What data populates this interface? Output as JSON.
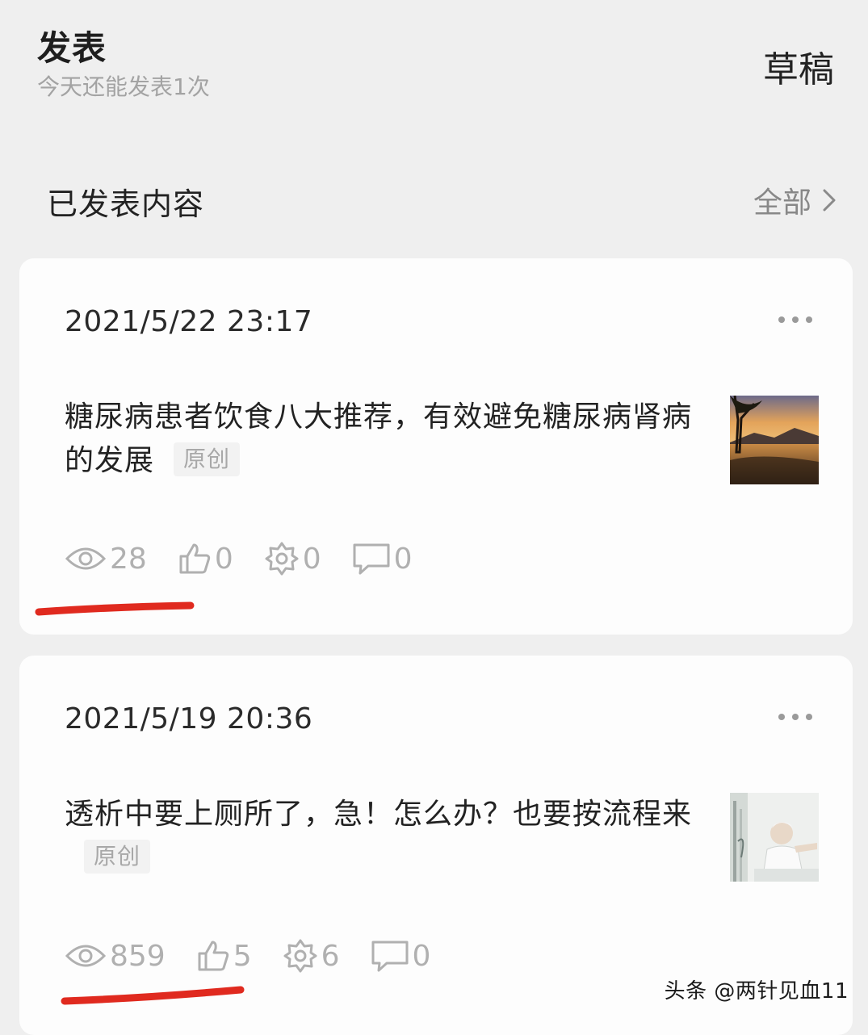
{
  "header": {
    "title": "发表",
    "subtitle": "今天还能发表1次",
    "drafts_label": "草稿"
  },
  "section": {
    "title": "已发表内容",
    "view_all_label": "全部"
  },
  "posts": [
    {
      "date": "2021/5/22 23:17",
      "title": "糖尿病患者饮食八大推荐，有效避免糖尿病肾病的发展",
      "tag": "原创",
      "thumbnail": "lake-sunset-thumbnail",
      "views": "28",
      "likes": "0",
      "shares": "0",
      "comments": "0"
    },
    {
      "date": "2021/5/19 20:36",
      "title": "透析中要上厕所了，急！怎么办？也要按流程来",
      "tag": "原创",
      "thumbnail": "hospital-patient-thumbnail",
      "views": "859",
      "likes": "5",
      "shares": "6",
      "comments": "0"
    }
  ],
  "watermark": "头条 @两针见血11",
  "colors": {
    "background": "#efefef",
    "card": "#fdfdfd",
    "underline": "#e02a1f",
    "stat_gray": "#b0b0b0"
  }
}
